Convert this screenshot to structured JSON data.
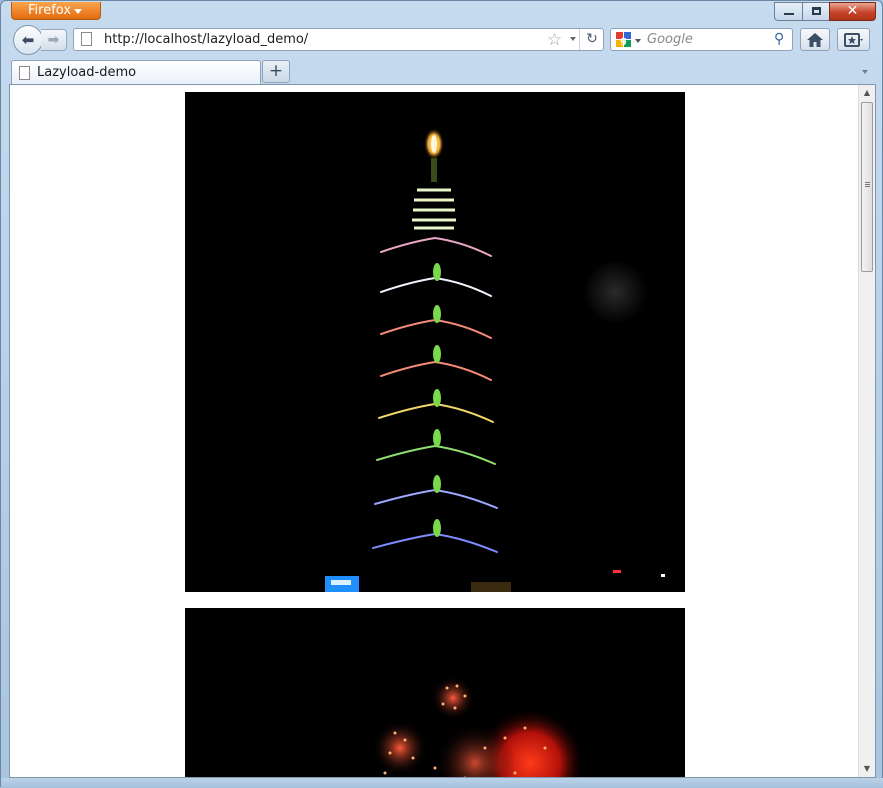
{
  "titlebar": {
    "app_menu_label": "Firefox",
    "minimize_label": "",
    "maximize_label": "",
    "close_label": "✕"
  },
  "navbar": {
    "url": "http://localhost/lazyload_demo/",
    "search_placeholder": "Google",
    "icons": [
      "back-arrow-icon",
      "forward-arrow-icon",
      "page-icon",
      "bookmark-star-icon",
      "reload-icon",
      "google-icon",
      "magnifier-icon",
      "home-icon",
      "bookmarks-icon"
    ]
  },
  "tabs": [
    {
      "title": "Lazyload-demo",
      "selected": true
    }
  ],
  "new_tab_label": "+",
  "content": {
    "images": [
      {
        "subject": "taipei-101-at-night",
        "visible_fraction": 1.0
      },
      {
        "subject": "fireworks",
        "visible_fraction": 0.4
      }
    ],
    "scroll_position_fraction": 0.0
  },
  "colors": {
    "firefox_orange": "#e36b10",
    "close_red": "#c7442a",
    "chrome_blue": "#c7dbef",
    "page_bg": "#ffffff",
    "photo_bg": "#000000"
  }
}
